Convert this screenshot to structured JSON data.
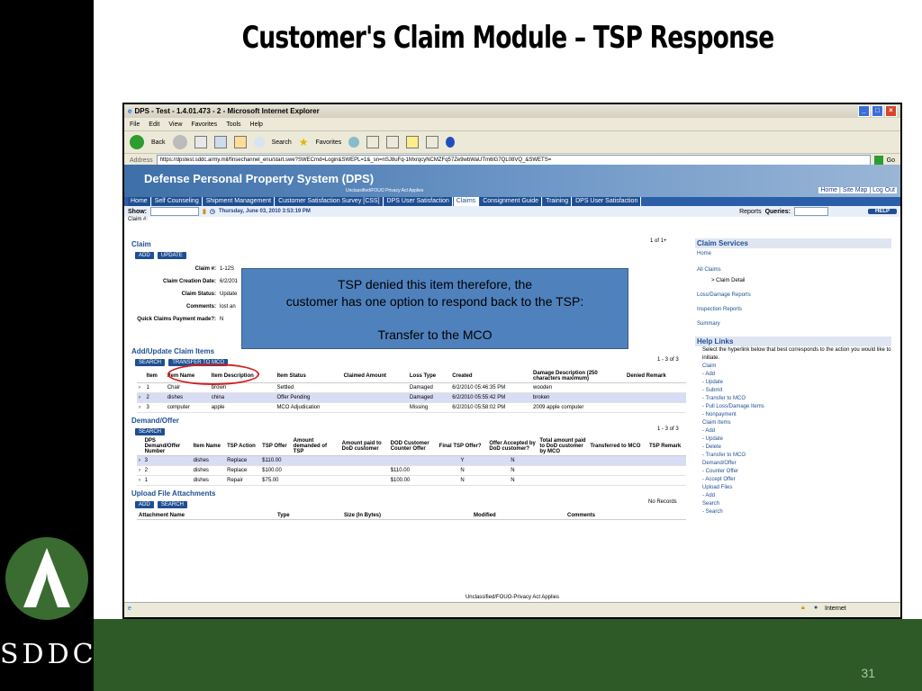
{
  "slide": {
    "title": "Customer's Claim Module – TSP Response",
    "number": "31",
    "logo_text": "SDDC"
  },
  "window": {
    "title": "DPS - Test - 1.4.01.473 - 2 - Microsoft Internet Explorer",
    "menu": [
      "File",
      "Edit",
      "View",
      "Favorites",
      "Tools",
      "Help"
    ],
    "back_label": "Back",
    "search_label": "Search",
    "favorites_label": "Favorites",
    "address_label": "Address",
    "address_url": "https://dpstest.sddc.army.mil/finsechannel_enu/start.swe?SWECmd=Login&SWEPL=1&_sn=nSJ8uFq-1MxrqcyNCMZFq57Ze9wbWaUTm6lG7QL08VQ_&SWETS=",
    "go_label": "Go",
    "status_internet": "Internet"
  },
  "app": {
    "banner_title": "Defense Personal Property System (DPS)",
    "banner_sub": "Unclassified/FOUO Privacy Act Applies",
    "banner_links": "Home | Site Map | Log Out",
    "nav_tabs": [
      "Home",
      "Self Counseling",
      "Shipment Management",
      "Customer Satisfaction Survey [CSS]",
      "DPS User Satisfaction",
      "Claims",
      "Consignment Guide",
      "Training",
      "DPS User Satisfaction"
    ],
    "show_label": "Show:",
    "datetime": "Thursday, June 03, 2010 3:53:19 PM",
    "reports_label": "Reports",
    "queries_label": "Queries:",
    "help_label": "HELP",
    "claim_num_label": "Claim #:",
    "footer": "Unclassified/FOUO-Privacy Act Applies"
  },
  "claim": {
    "title": "Claim",
    "add_btn": "ADD",
    "update_btn": "UPDATE",
    "pager": "1 of 1+",
    "fields": [
      {
        "label": "Claim #:",
        "value": "1-12S"
      },
      {
        "label": "Claim Creation Date:",
        "value": "6/2/201"
      },
      {
        "label": "Claim Status:",
        "value": "Update"
      },
      {
        "label": "Comments:",
        "value": "lost an"
      },
      {
        "label": "Quick Claims Payment made?:",
        "value": "N"
      }
    ]
  },
  "items": {
    "title": "Add/Update Claim Items",
    "search_btn": "SEARCH",
    "transfer_btn": "TRANSFER TO MCO",
    "pager": "1 - 3 of 3",
    "headers": [
      "",
      "Item",
      "Item Name",
      "Item Description",
      "Item Status",
      "Claimed Amount",
      "Loss Type",
      "Created",
      "Damage Description (250 characters maximum)",
      "Denied Remark"
    ],
    "rows": [
      [
        "›",
        "1",
        "Chair",
        "brown",
        "Settled",
        "",
        "Damaged",
        "6/2/2010 05:46:35 PM",
        "wooden",
        ""
      ],
      [
        "›",
        "2",
        "dishes",
        "china",
        "Offer Pending",
        "",
        "Damaged",
        "6/2/2010 05:55:42 PM",
        "broken",
        ""
      ],
      [
        "›",
        "3",
        "computer",
        "apple",
        "MCO Adjudication",
        "",
        "Missing",
        "6/2/2010 05:58:02 PM",
        "2009 apple computer",
        ""
      ]
    ]
  },
  "demand": {
    "title": "Demand/Offer",
    "search_btn": "SEARCH",
    "pager": "1 - 3 of 3",
    "headers": [
      "",
      "DPS Demand/Offer Number",
      "Item Name",
      "TSP Action",
      "TSP Offer",
      "Amount demanded of TSP",
      "Amount paid to DoD customer",
      "DOD Customer Counter Offer",
      "Final TSP Offer?",
      "Offer Accepted by DoD customer?",
      "Total amount paid to DoD customer by MCO",
      "Transferred to MCO",
      "TSP Remark"
    ],
    "rows": [
      [
        "›",
        "3",
        "dishes",
        "Replace",
        "$110.00",
        "",
        "",
        "",
        "Y",
        "N",
        "",
        "",
        ""
      ],
      [
        "›",
        "2",
        "dishes",
        "Replace",
        "$100.00",
        "",
        "",
        "$110.00",
        "N",
        "N",
        "",
        "",
        ""
      ],
      [
        "›",
        "1",
        "dishes",
        "Repair",
        "$75.00",
        "",
        "",
        "$100.00",
        "N",
        "N",
        "",
        "",
        ""
      ]
    ]
  },
  "upload": {
    "title": "Upload File Attachments",
    "add_btn": "ADD",
    "search_btn": "SEARCH",
    "pager": "No Records",
    "headers": [
      "Attachment Name",
      "Type",
      "Size (In Bytes)",
      "Modified",
      "Comments"
    ]
  },
  "sidebar": {
    "services_title": "Claim Services",
    "links": [
      "Home",
      "All Claims",
      "> Claim Detail",
      "Loss/Damage Reports",
      "Inspection Reports",
      "Summary"
    ],
    "help_title": "Help Links",
    "help_intro": "Select the hyperlink below that best corresponds to the action you would like to initiate.",
    "help_items": [
      "Claim",
      "- Add",
      "- Update",
      "- Submit",
      "- Transfer to MCO",
      "- Pull Loss/Damage Items",
      "- Nonpayment",
      "Claim Items",
      "- Add",
      "- Update",
      "- Delete",
      "- Transfer to MCO",
      "Demand/Offer",
      "- Counter Offer",
      "- Accept Offer",
      "Upload Files",
      "- Add",
      "Search",
      "- Search"
    ]
  },
  "callout": {
    "line1": "TSP denied this item therefore, the",
    "line2": "customer has one option to respond back to the TSP:",
    "line3": "Transfer to the MCO"
  },
  "colors": {
    "brand_blue": "#1f4f92",
    "callout_blue": "#4f81bd",
    "slide_green": "#2e5a27",
    "highlight_oval": "#d42020"
  }
}
